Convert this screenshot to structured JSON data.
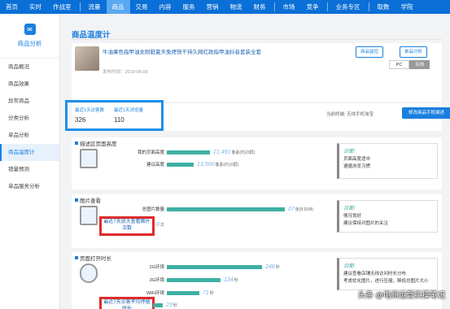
{
  "nav": {
    "items": [
      "首页",
      "实时",
      "作战室",
      "流量",
      "商品",
      "交易",
      "内容",
      "服务",
      "营销",
      "物流",
      "财务",
      "市场",
      "竞争",
      "业务专区",
      "取数",
      "学院"
    ],
    "active_index": 4
  },
  "sidebar": {
    "title": "商品分析",
    "items": [
      "商品概况",
      "商品效果",
      "异常商品",
      "分类分析",
      "单品分析",
      "商品温度计",
      "销量预测",
      "单品服务分析"
    ],
    "active_index": 5
  },
  "page": {
    "title": "商品温度计"
  },
  "product": {
    "name": "牛油果色指甲油女耐脏夏天免烤快干持久网红款指甲油抖音套装全套",
    "date": "发布时间：2019-05-08",
    "btn_monitor": "商品监控",
    "btn_analysis": "单品分析"
  },
  "terminal": {
    "pc": "PC",
    "wireless": "无线",
    "active": "wireless"
  },
  "stats": {
    "uv_label": "最近1天访客数",
    "uv_value": "326",
    "pv_label": "最近1天浏览量",
    "pv_value": "110",
    "current_terminal": "当前终端: 无线手机淘宝",
    "btn_mobile_detail": "修改商品手机描述"
  },
  "section_desc": {
    "title": "描述区页面高度",
    "rows": [
      {
        "label": "我的页面高度",
        "value": "21,491",
        "unit": "像素(约23屏)",
        "ratio": 0.24
      },
      {
        "label": "建议高度",
        "value": "13,500",
        "unit": "像素(约10屏)",
        "ratio": 0.15
      }
    ],
    "diag_title": "诊断:",
    "diag_lines": [
      "页面高度适中",
      "遵循浏览习惯"
    ]
  },
  "section_image": {
    "title": "图片查看",
    "rows": [
      {
        "label": "总图片数量",
        "value": "67",
        "unit": "张(9.91M)",
        "ratio": 0.66
      }
    ],
    "highlight_label": "最近7天放大查看图片次数",
    "highlight_value": "0",
    "highlight_unit": "次",
    "diag_title": "诊断:",
    "diag_lines": [
      "情况良好",
      "建议保持对图片的关注"
    ]
  },
  "section_load": {
    "title": "页面打开时长",
    "rows": [
      {
        "label": "2G环境",
        "value": "248",
        "unit": "秒",
        "ratio": 0.53
      },
      {
        "label": "3G环境",
        "value": "134",
        "unit": "秒",
        "ratio": 0.3
      },
      {
        "label": "WiFi环境",
        "value": "71",
        "unit": "秒",
        "ratio": 0.18
      }
    ],
    "highlight_label": "最近7天访客平均停留时长",
    "highlight_value": "23",
    "highlight_unit": "秒",
    "diag_title": "诊断:",
    "diag_lines": [
      "建议查看店铺无线访问时长分布",
      "考虑优化图片，进行压缩，降低总图片大小"
    ]
  },
  "watermark": "头条 @电商运营实操笔记"
}
